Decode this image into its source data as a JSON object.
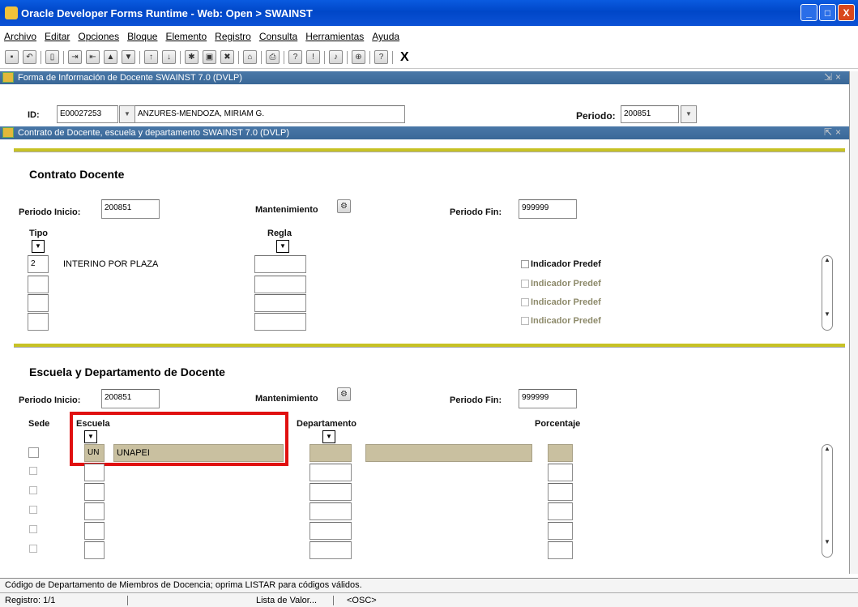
{
  "window": {
    "title": "Oracle Developer Forms Runtime - Web:  Open > SWAINST",
    "buttons": [
      "_",
      "□",
      "X"
    ]
  },
  "menu": [
    "Archivo",
    "Editar",
    "Opciones",
    "Bloque",
    "Elemento",
    "Registro",
    "Consulta",
    "Herramientas",
    "Ayuda"
  ],
  "toolbar": {
    "close_label": "X"
  },
  "form1": {
    "title": "Forma de Información de Docente  SWAINST  7.0  (DVLP)",
    "id_label": "ID:",
    "id_value": "E00027253",
    "name_value": "ANZURES-MENDOZA, MIRIAM G.",
    "periodo_label": "Periodo:",
    "periodo_value": "200851"
  },
  "form2": {
    "title": "Contrato de Docente, escuela y departamento  SWAINST  7.0  (DVLP)"
  },
  "contrato": {
    "header": "Contrato Docente",
    "periodo_inicio_label": "Periodo Inicio:",
    "periodo_inicio_value": "200851",
    "mantenimiento_label": "Mantenimiento",
    "periodo_fin_label": "Periodo Fin:",
    "periodo_fin_value": "999999",
    "tipo_label": "Tipo",
    "regla_label": "Regla",
    "rows": [
      {
        "tipo": "2",
        "desc": "INTERINO POR PLAZA",
        "indicador": "Indicador Predef"
      },
      {
        "tipo": "",
        "desc": "",
        "indicador": "Indicador Predef"
      },
      {
        "tipo": "",
        "desc": "",
        "indicador": "Indicador Predef"
      },
      {
        "tipo": "",
        "desc": "",
        "indicador": "Indicador Predef"
      }
    ]
  },
  "escuela": {
    "header": "Escuela y Departamento de Docente",
    "periodo_inicio_label": "Periodo Inicio:",
    "periodo_inicio_value": "200851",
    "mantenimiento_label": "Mantenimiento",
    "periodo_fin_label": "Periodo Fin:",
    "periodo_fin_value": "999999",
    "sede_label": "Sede",
    "escuela_label": "Escuela",
    "departamento_label": "Departamento",
    "porcentaje_label": "Porcentaje",
    "rows": [
      {
        "code": "UN",
        "name": "UNAPEI"
      },
      {
        "code": "",
        "name": ""
      },
      {
        "code": "",
        "name": ""
      },
      {
        "code": "",
        "name": ""
      },
      {
        "code": "",
        "name": ""
      },
      {
        "code": "",
        "name": ""
      }
    ]
  },
  "status": {
    "message": "Código de Departamento de Miembros de Docencia; oprima LISTAR para códigos válidos.",
    "registro": "Registro: 1/1",
    "lista": "Lista de Valor...",
    "osc": "<OSC>"
  },
  "colors": {
    "titlebar": "#0047c8",
    "panelbar": "#3a6897",
    "highlight": "#c9c0a0",
    "section_line": "#c7c225",
    "red_box": "#e01010"
  }
}
